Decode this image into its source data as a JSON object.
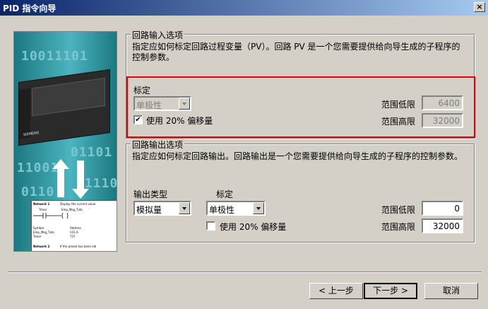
{
  "window": {
    "title": "PID 指令向导",
    "close_glyph": "×"
  },
  "illustration": {
    "digits": [
      "10011101",
      "01101",
      "11001",
      "01110",
      "0110"
    ],
    "plc_label": "SIEMENS",
    "ladder": {
      "network1": "Network 1",
      "network1_comment": "Display the current value",
      "contact": "Timer",
      "coil": "Emp_Msg_Txto",
      "symbol_header": "Symbol",
      "address_header": "Address",
      "row1_sym": "Emp_Msg_Txto",
      "row1_addr": "V31.6",
      "row2_sym": "Timer",
      "row2_addr": "T37",
      "network2": "Network 2",
      "network2_comment": "If the preset has been edi"
    }
  },
  "input_group": {
    "legend": "回路输入选项",
    "description": "指定应如何标定回路过程变量（PV）。回路 PV 是一个您需要提供给向导生成的子程序的控制参数。",
    "scale_label": "标定",
    "scale_value": "单极性",
    "offset_checked": true,
    "offset_label": "使用 20% 偏移量",
    "low_label": "范围低限",
    "low_value": "6400",
    "high_label": "范围高限",
    "high_value": "32000"
  },
  "output_group": {
    "legend": "回路输出选项",
    "description": "指定应如何标定回路输出。回路输出是一个您需要提供给向导生成的子程序的控制参数。",
    "type_label": "输出类型",
    "type_value": "模拟量",
    "scale_label": "标定",
    "scale_value": "单极性",
    "offset_checked": false,
    "offset_label": "使用 20% 偏移量",
    "low_label": "范围低限",
    "low_value": "0",
    "high_label": "范围高限",
    "high_value": "32000"
  },
  "buttons": {
    "back": "< 上一步",
    "next": "下一步 >",
    "cancel": "取消"
  },
  "colors": {
    "highlight": "#e00000",
    "titlebar_start": "#0a246a",
    "titlebar_end": "#a6caf0"
  }
}
